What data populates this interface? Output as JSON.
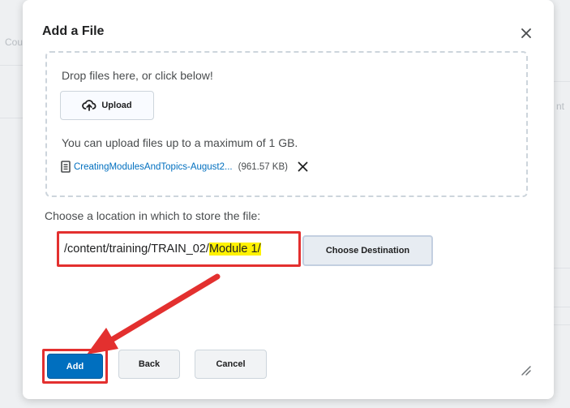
{
  "background": {
    "left_text": "Cou",
    "right_text": "nt"
  },
  "dialog": {
    "title": "Add a File",
    "close_icon": "close-icon",
    "dropzone": {
      "instructions": "Drop files here, or click below!",
      "upload_label": "Upload",
      "upload_icon": "cloud-upload-icon",
      "limit_text": "You can upload files up to a maximum of 1 GB.",
      "file": {
        "icon": "document-icon",
        "name": "CreatingModulesAndTopics-August2...",
        "size": "(961.57 KB)",
        "remove_icon": "remove-icon"
      }
    },
    "location": {
      "label": "Choose a location in which to store the file:",
      "path_prefix": "/content/training/TRAIN_02/",
      "path_highlight": "Module 1/",
      "choose_label": "Choose Destination"
    },
    "footer": {
      "add_label": "Add",
      "back_label": "Back",
      "cancel_label": "Cancel",
      "resize_icon": "resize-handle-icon"
    }
  },
  "colors": {
    "primary": "#006fbf",
    "annotation": "#e3302f",
    "highlight": "#fff200"
  }
}
